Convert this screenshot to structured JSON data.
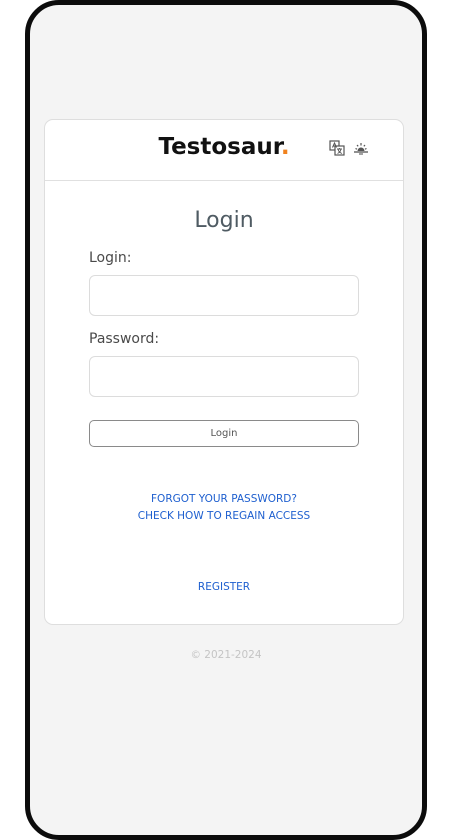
{
  "header": {
    "brand_name": "Testosaur",
    "brand_dot": ".",
    "icons": [
      "translate-icon",
      "theme-sunrise-icon"
    ],
    "accent_color": "#f0821e"
  },
  "form": {
    "title": "Login",
    "login_label": "Login:",
    "login_value": "",
    "password_label": "Password:",
    "password_value": "",
    "submit_label": "Login"
  },
  "links": {
    "forgot_password": "FORGOT YOUR PASSWORD?",
    "regain_access": "CHECK HOW TO REGAIN ACCESS",
    "register": "REGISTER",
    "link_color": "#1e5fcf"
  },
  "footer": {
    "copyright": "© 2021-2024"
  }
}
